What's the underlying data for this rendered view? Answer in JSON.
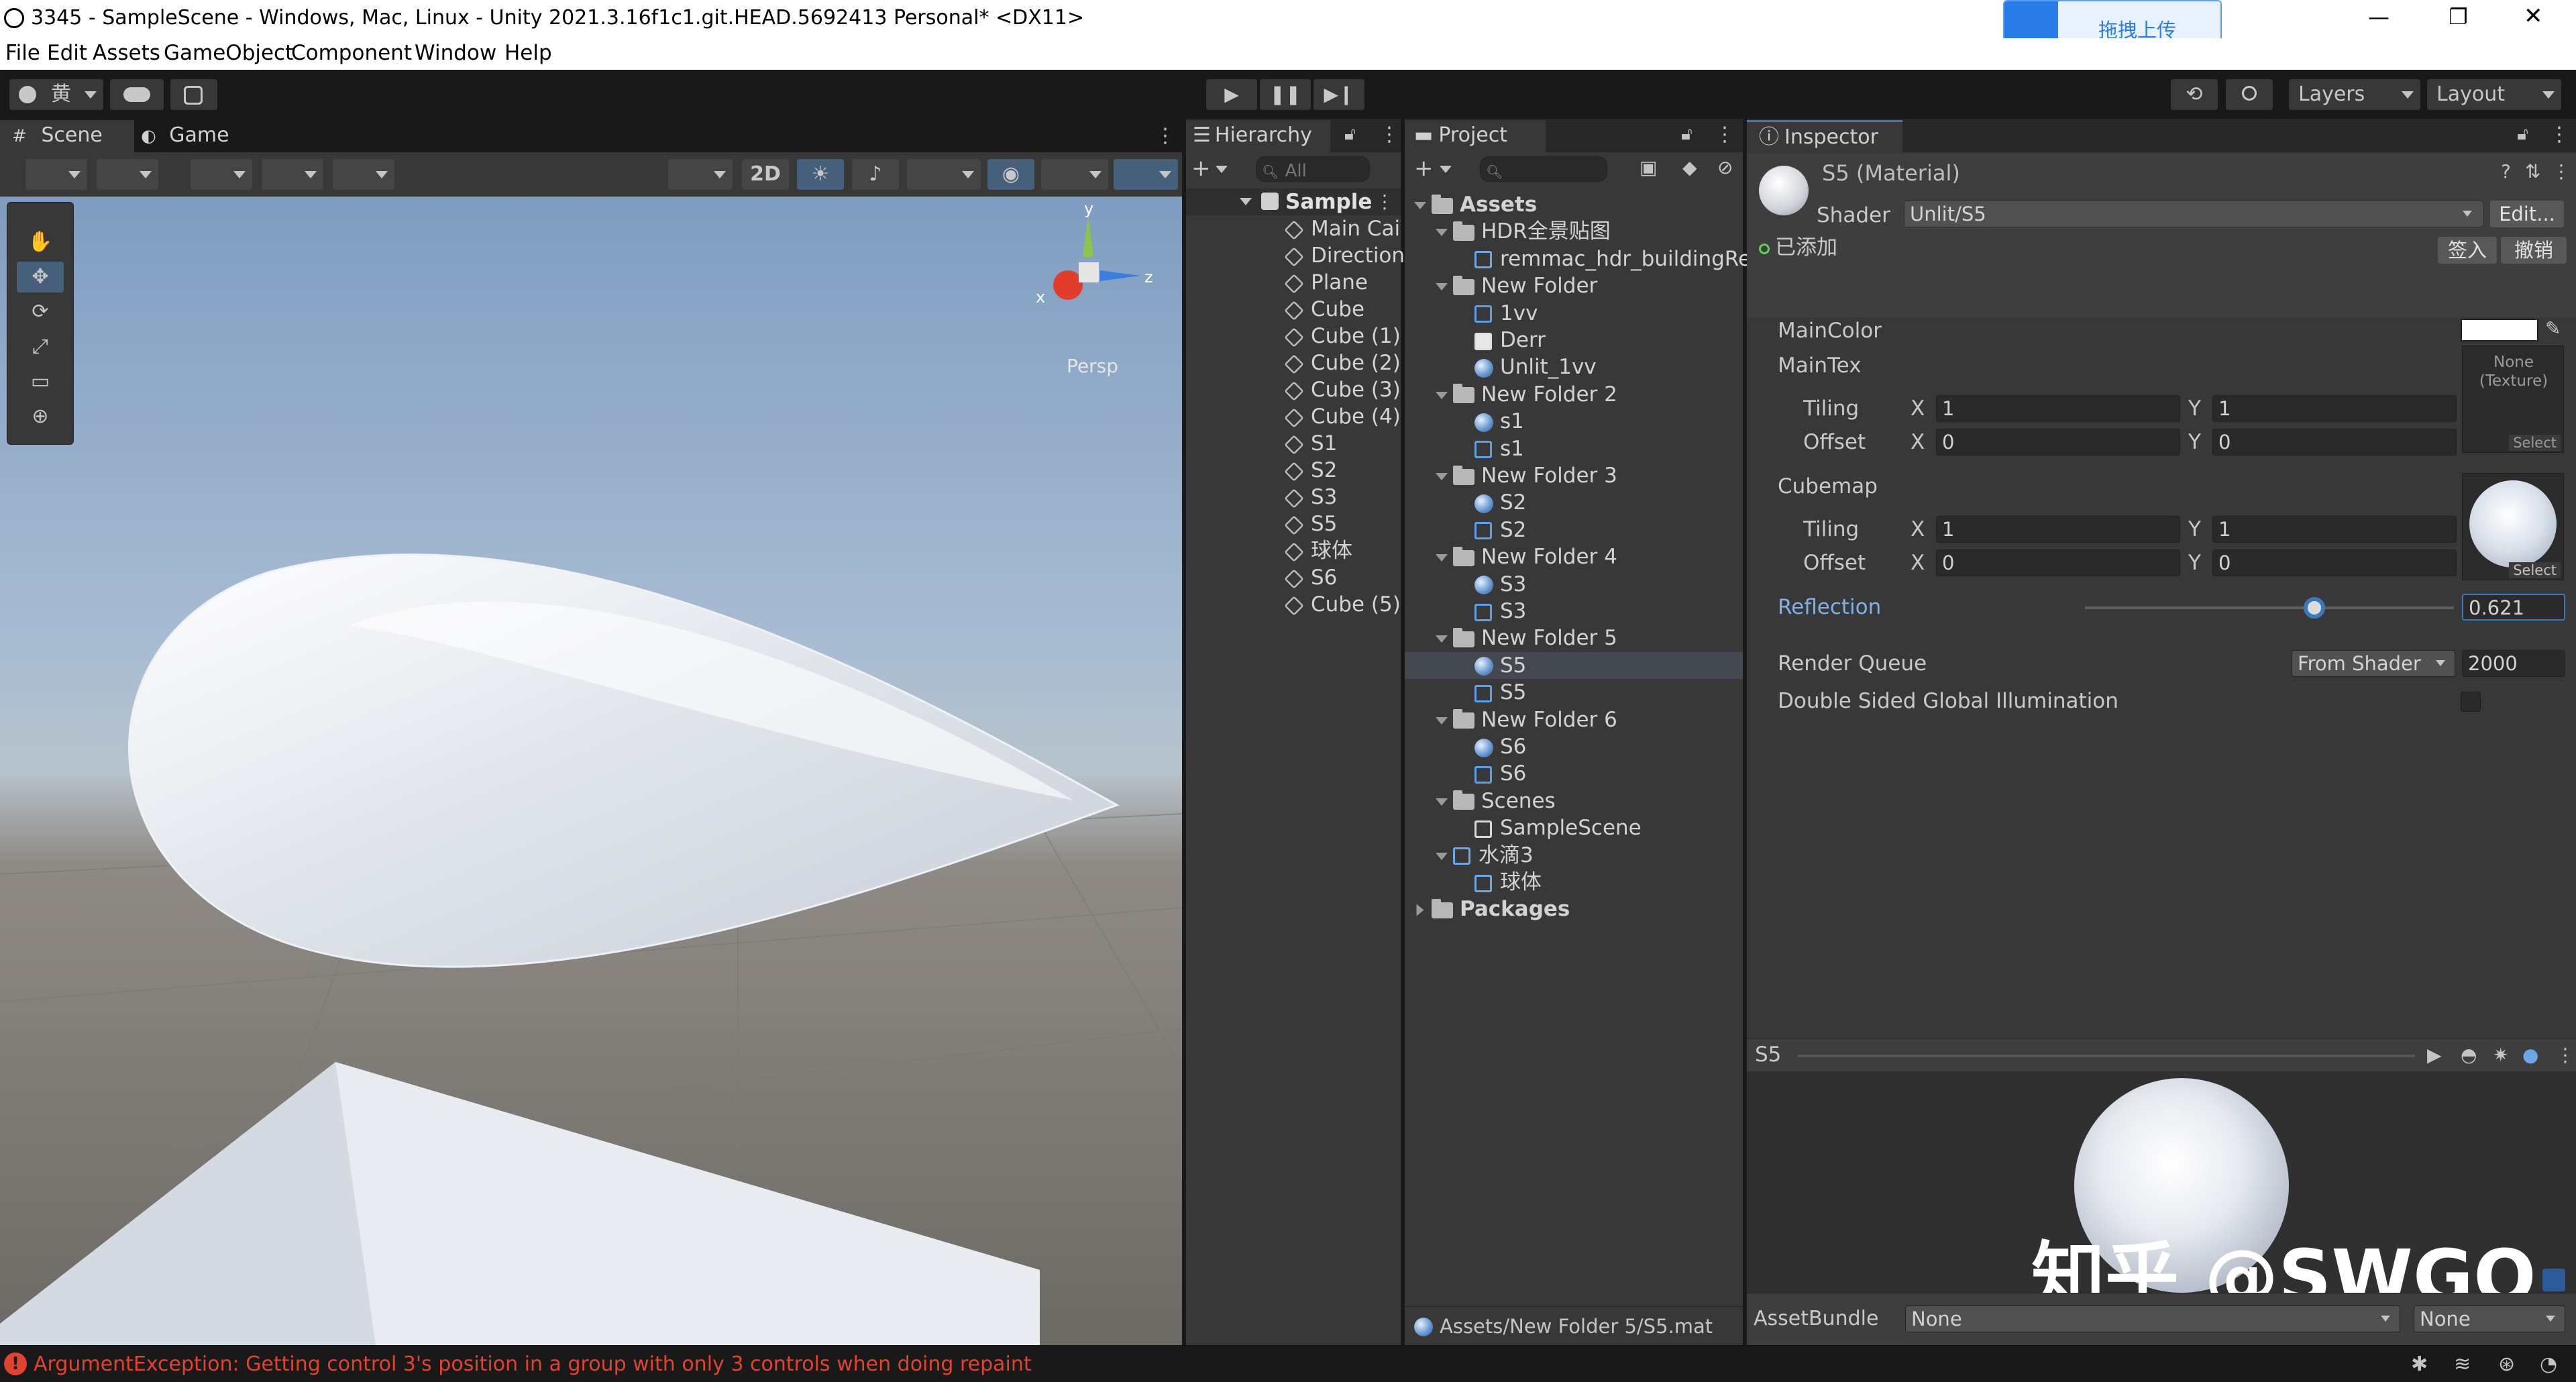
{
  "window": {
    "title": "3345 - SampleScene - Windows, Mac, Linux - Unity 2021.3.16f1c1.git.HEAD.5692413 Personal* <DX11>",
    "upload_label": "拖拽上传"
  },
  "menu": [
    "File",
    "Edit",
    "Assets",
    "GameObject",
    "Component",
    "Window",
    "Help"
  ],
  "toolbar": {
    "account": "黄",
    "layers": "Layers",
    "layout": "Layout"
  },
  "scene": {
    "tab_scene": "Scene",
    "tab_game": "Game",
    "btn_2d": "2D",
    "persp": "Persp",
    "axis_x": "x",
    "axis_y": "y",
    "axis_z": "z"
  },
  "hierarchy": {
    "tab": "Hierarchy",
    "search": "All",
    "root": "Sample",
    "items": [
      "Main Cai",
      "Direction",
      "Plane",
      "Cube",
      "Cube (1)",
      "Cube (2)",
      "Cube (3)",
      "Cube (4)",
      "S1",
      "S2",
      "S3",
      "S5",
      "球体",
      "S6",
      "Cube (5)"
    ]
  },
  "project": {
    "tab": "Project",
    "footer": "Assets/New Folder 5/S5.mat",
    "tree": [
      {
        "label": "Assets",
        "indent": 0,
        "icon": "folder",
        "bold": true
      },
      {
        "label": "HDR全景贴图",
        "indent": 1,
        "icon": "folder"
      },
      {
        "label": "remmac_hdr_buildingRef",
        "indent": 2,
        "icon": "texture"
      },
      {
        "label": "New Folder",
        "indent": 1,
        "icon": "folder"
      },
      {
        "label": "1vv",
        "indent": 2,
        "icon": "shader"
      },
      {
        "label": "Derr",
        "indent": 2,
        "icon": "script"
      },
      {
        "label": "Unlit_1vv",
        "indent": 2,
        "icon": "material"
      },
      {
        "label": "New Folder 2",
        "indent": 1,
        "icon": "folder"
      },
      {
        "label": "s1",
        "indent": 2,
        "icon": "material"
      },
      {
        "label": "s1",
        "indent": 2,
        "icon": "shader"
      },
      {
        "label": "New Folder 3",
        "indent": 1,
        "icon": "folder"
      },
      {
        "label": "S2",
        "indent": 2,
        "icon": "material"
      },
      {
        "label": "S2",
        "indent": 2,
        "icon": "shader"
      },
      {
        "label": "New Folder 4",
        "indent": 1,
        "icon": "folder"
      },
      {
        "label": "S3",
        "indent": 2,
        "icon": "material"
      },
      {
        "label": "S3",
        "indent": 2,
        "icon": "shader"
      },
      {
        "label": "New Folder 5",
        "indent": 1,
        "icon": "folder"
      },
      {
        "label": "S5",
        "indent": 2,
        "icon": "material",
        "selected": true
      },
      {
        "label": "S5",
        "indent": 2,
        "icon": "shader"
      },
      {
        "label": "New Folder 6",
        "indent": 1,
        "icon": "folder"
      },
      {
        "label": "S6",
        "indent": 2,
        "icon": "material"
      },
      {
        "label": "S6",
        "indent": 2,
        "icon": "shader"
      },
      {
        "label": "Scenes",
        "indent": 1,
        "icon": "folder"
      },
      {
        "label": "SampleScene",
        "indent": 2,
        "icon": "scene"
      },
      {
        "label": "水滴3",
        "indent": 1,
        "icon": "model"
      },
      {
        "label": "球体",
        "indent": 2,
        "icon": "mesh"
      },
      {
        "label": "Packages",
        "indent": 0,
        "icon": "folder",
        "bold": true
      }
    ]
  },
  "inspector": {
    "tab": "Inspector",
    "title": "S5 (Material)",
    "shader_label": "Shader",
    "shader_value": "Unlit/S5",
    "edit": "Edit...",
    "added": "已添加",
    "checkin": "签入",
    "revert": "撤销",
    "main_color": "MainColor",
    "main_tex": "MainTex",
    "none_texture": "None\n(Texture)",
    "select": "Select",
    "tiling": "Tiling",
    "offset": "Offset",
    "x": "X",
    "y": "Y",
    "tile_x": "1",
    "tile_y": "1",
    "off_x": "0",
    "off_y": "0",
    "cubemap": "Cubemap",
    "reflection": "Reflection",
    "reflection_value": "0.621",
    "reflection_fraction": 0.621,
    "render_queue": "Render Queue",
    "rq_mode": "From Shader",
    "rq_value": "2000",
    "double_sided": "Double Sided Global Illumination",
    "preview_name": "S5",
    "assetbundle": "AssetBundle",
    "ab_value": "None",
    "ab_variant": "None",
    "watermark": "知乎 @SWGQ"
  },
  "status": {
    "error": "ArgumentException: Getting control 3's position in a group with only 3 controls when doing repaint"
  },
  "colors": {
    "accent": "#4a8fd4",
    "error": "#e0442f",
    "selected_row": "#44494f"
  }
}
